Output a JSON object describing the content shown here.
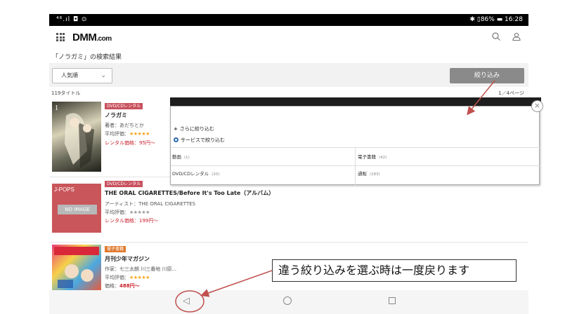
{
  "statusbar": {
    "left": "⁴⁶.ıl ◘ ⊙",
    "right": "✱ ▯86% ▬ 16:28"
  },
  "header": {
    "logo_main": "DMM",
    "logo_dom": ".com",
    "search_icon": "search-icon",
    "account_icon": "user-icon"
  },
  "results_title": "「ノラガミ」の検索結果",
  "sort": {
    "selected": "人気順"
  },
  "filter_button": "絞り込み",
  "count": "119タイトル",
  "page_info": "1／4ページ",
  "items": [
    {
      "badge": "DVD/CDレンタル",
      "title": "ノラガミ",
      "meta": "著者：あだちとか",
      "rating_label": "平均評価：",
      "stars": "★★★★★",
      "price": "レンタル価格：95円〜"
    },
    {
      "badge": "DVD/CDレンタル",
      "title": "THE ORAL CIGARETTES/Before It's Too Late（アルバム）",
      "meta": "アーティスト：THE ORAL CIGARETTES",
      "rating_label": "平均評価：",
      "stars": "★★★★★",
      "price": "レンタル価格：199円〜",
      "thumb_label": "J-POPS",
      "thumb_noimage": "NO IMAGE"
    },
    {
      "badge": "電子書籍",
      "title": "月刊少年マガジン",
      "meta": "作家：七三太朗 川三番地 川原...",
      "rating_label": "平均評価：",
      "stars": "★★★★★",
      "price_label": "価格：",
      "price_value": "488円〜"
    }
  ],
  "panel": {
    "more_filter": "さらに絞り込む",
    "service_filter": "サービスで絞り込む",
    "cells": [
      {
        "label": "動画",
        "count": "(1)"
      },
      {
        "label": "電子書籍",
        "count": "(42)"
      },
      {
        "label": "DVD/CDレンタル",
        "count": "(20)"
      },
      {
        "label": "通販",
        "count": "(183)"
      }
    ],
    "close": "×"
  },
  "annotation": "違う絞り込みを選ぶ時は一度戻ります",
  "colors": {
    "price_red": "#c81e28",
    "badge_red": "#c8505c",
    "badge_orange": "#e07a2e",
    "annotation_red": "#c0504d"
  }
}
